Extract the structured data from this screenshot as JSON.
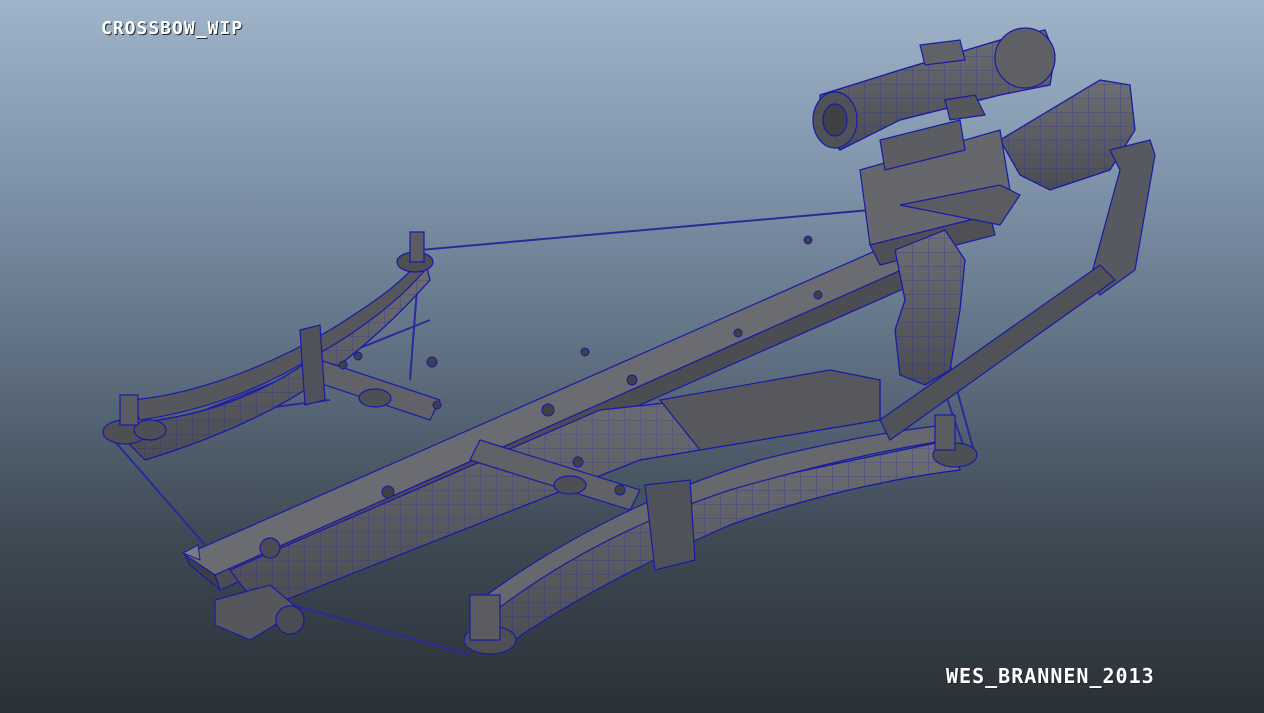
{
  "viewport": {
    "title": "CROSSBOW_WIP",
    "credit": "WES_BRANNEN_2013"
  },
  "model": {
    "description_icon": "crossbow-wireframe-icon",
    "colors": {
      "surface": "#5c5e63",
      "surface_dark": "#45474c",
      "surface_light": "#75777c",
      "wire": "#1a1aa6",
      "string": "#2a2a9a"
    }
  }
}
